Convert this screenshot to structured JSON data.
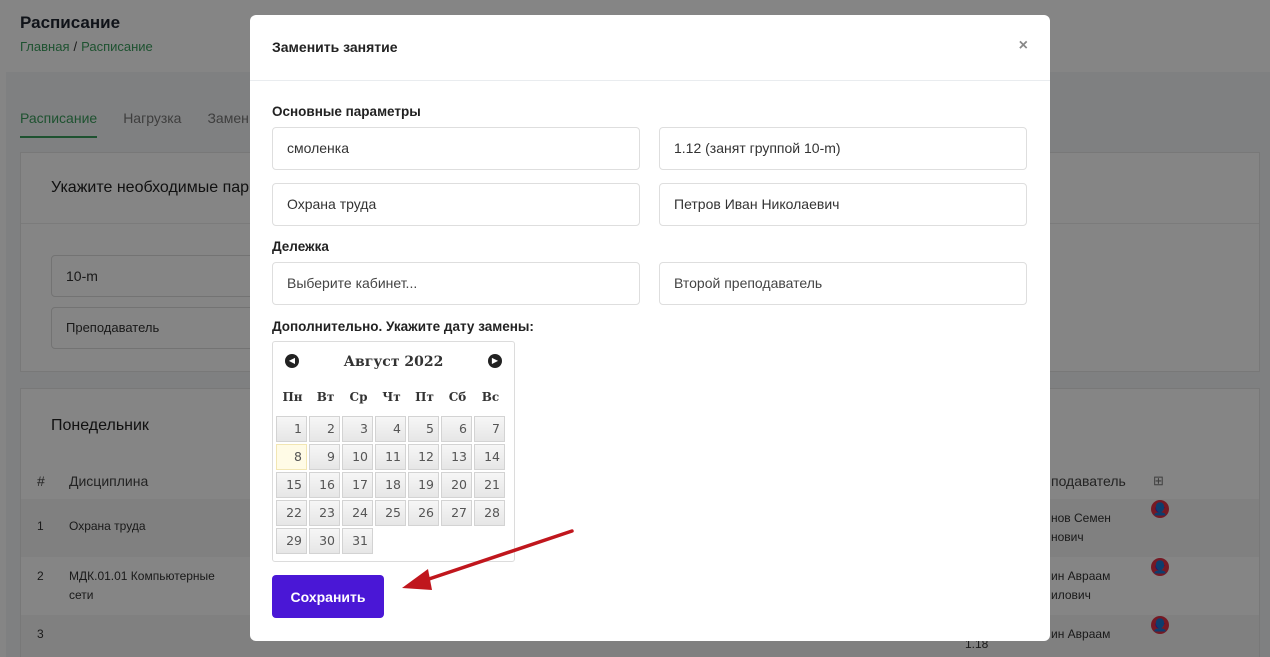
{
  "page": {
    "title": "Расписание",
    "breadcrumb": [
      "Главная",
      "Расписание"
    ],
    "tabs": [
      "Расписание",
      "Нагрузка",
      "Замен"
    ],
    "params_title": "Укажите необходимые пар",
    "group_value": "10-m",
    "teacher_placeholder": "Преподаватель",
    "day_title": "Понедельник",
    "table_headers": {
      "num": "#",
      "discipline": "Дисциплина",
      "teacher": "подаватель"
    },
    "rows": [
      {
        "num": "1",
        "discipline": "Охрана труда",
        "teacher": "нов Семен",
        "teacher2": "нович"
      },
      {
        "num": "2",
        "discipline": "МДК.01.01 Компьютерные",
        "discipline2": "сети",
        "teacher": "ин Авраам",
        "teacher2": "илович"
      },
      {
        "num": "3",
        "discipline": "",
        "teacher": "ин Авраам",
        "room": "1.18"
      }
    ]
  },
  "modal": {
    "title": "Заменить занятие",
    "close_glyph": "×",
    "basic_label": "Основные параметры",
    "fields": {
      "building": "смоленка",
      "room": "1.12 (занят группой 10-m)",
      "subject": "Охрана труда",
      "teacher": "Петров Иван Николаевич"
    },
    "split_label": "Дележка",
    "split_fields": {
      "room_placeholder": "Выберите кабинет...",
      "teacher_placeholder": "Второй преподаватель"
    },
    "extra_label": "Дополнительно. Укажите дату замены:",
    "calendar": {
      "month_title": "Август 2022",
      "prev_icon": "◀",
      "next_icon": "▶",
      "weekdays": [
        "Пн",
        "Вт",
        "Ср",
        "Чт",
        "Пт",
        "Сб",
        "Вс"
      ],
      "days": [
        "1",
        "2",
        "3",
        "4",
        "5",
        "6",
        "7",
        "8",
        "9",
        "10",
        "11",
        "12",
        "13",
        "14",
        "15",
        "16",
        "17",
        "18",
        "19",
        "20",
        "21",
        "22",
        "23",
        "24",
        "25",
        "26",
        "27",
        "28",
        "29",
        "30",
        "31"
      ],
      "today": "8"
    },
    "save_label": "Сохранить"
  },
  "colors": {
    "accent": "#4a17d6",
    "link": "#3a9d5d",
    "arrow": "#c0161d"
  }
}
